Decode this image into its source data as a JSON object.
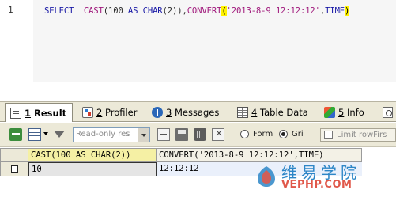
{
  "editor": {
    "line_number": "1",
    "code": {
      "t_select": "SELECT",
      "t_cast": "CAST",
      "t_cast_arg_open": "(100",
      "t_as": "AS",
      "t_char": "CHAR",
      "t_char_len": "(2)",
      "t_cast_close": "),",
      "t_convert": "CONVERT",
      "t_paren_open": "(",
      "t_datetime": "'2013-8-9 12:12:12'",
      "t_comma": ",",
      "t_time": "TIME",
      "t_paren_close": ")"
    }
  },
  "tabs": [
    {
      "num": "1",
      "label": "Result",
      "icon": "result-icon"
    },
    {
      "num": "2",
      "label": "Profiler",
      "icon": "profiler-icon"
    },
    {
      "num": "3",
      "label": "Messages",
      "icon": "messages-icon"
    },
    {
      "num": "4",
      "label": "Table Data",
      "icon": "table-data-icon"
    },
    {
      "num": "5",
      "label": "Info",
      "icon": "info-icon"
    },
    {
      "num": "",
      "label": "",
      "icon": "history-icon"
    }
  ],
  "toolbar": {
    "readonly_value": "Read-only res",
    "form_label": "Form",
    "grid_label": "Gri",
    "limit_label": "Limit rowFirs",
    "view_mode_selected": "grid"
  },
  "grid": {
    "columns": [
      "CAST(100 AS CHAR(2))",
      "CONVERT('2013-8-9 12:12:12',TIME)"
    ],
    "rows": [
      [
        "10",
        "12:12:12"
      ]
    ]
  },
  "watermark": {
    "title": "维易学院",
    "url": "VEPHP.COM"
  },
  "colors": {
    "keyword": "#1a1aa6",
    "function": "#a0197c",
    "paren_highlight": "#fff200",
    "selected_header": "#f5f0a4",
    "watermark_blue": "#2d86c7",
    "watermark_red": "#e0584a"
  }
}
